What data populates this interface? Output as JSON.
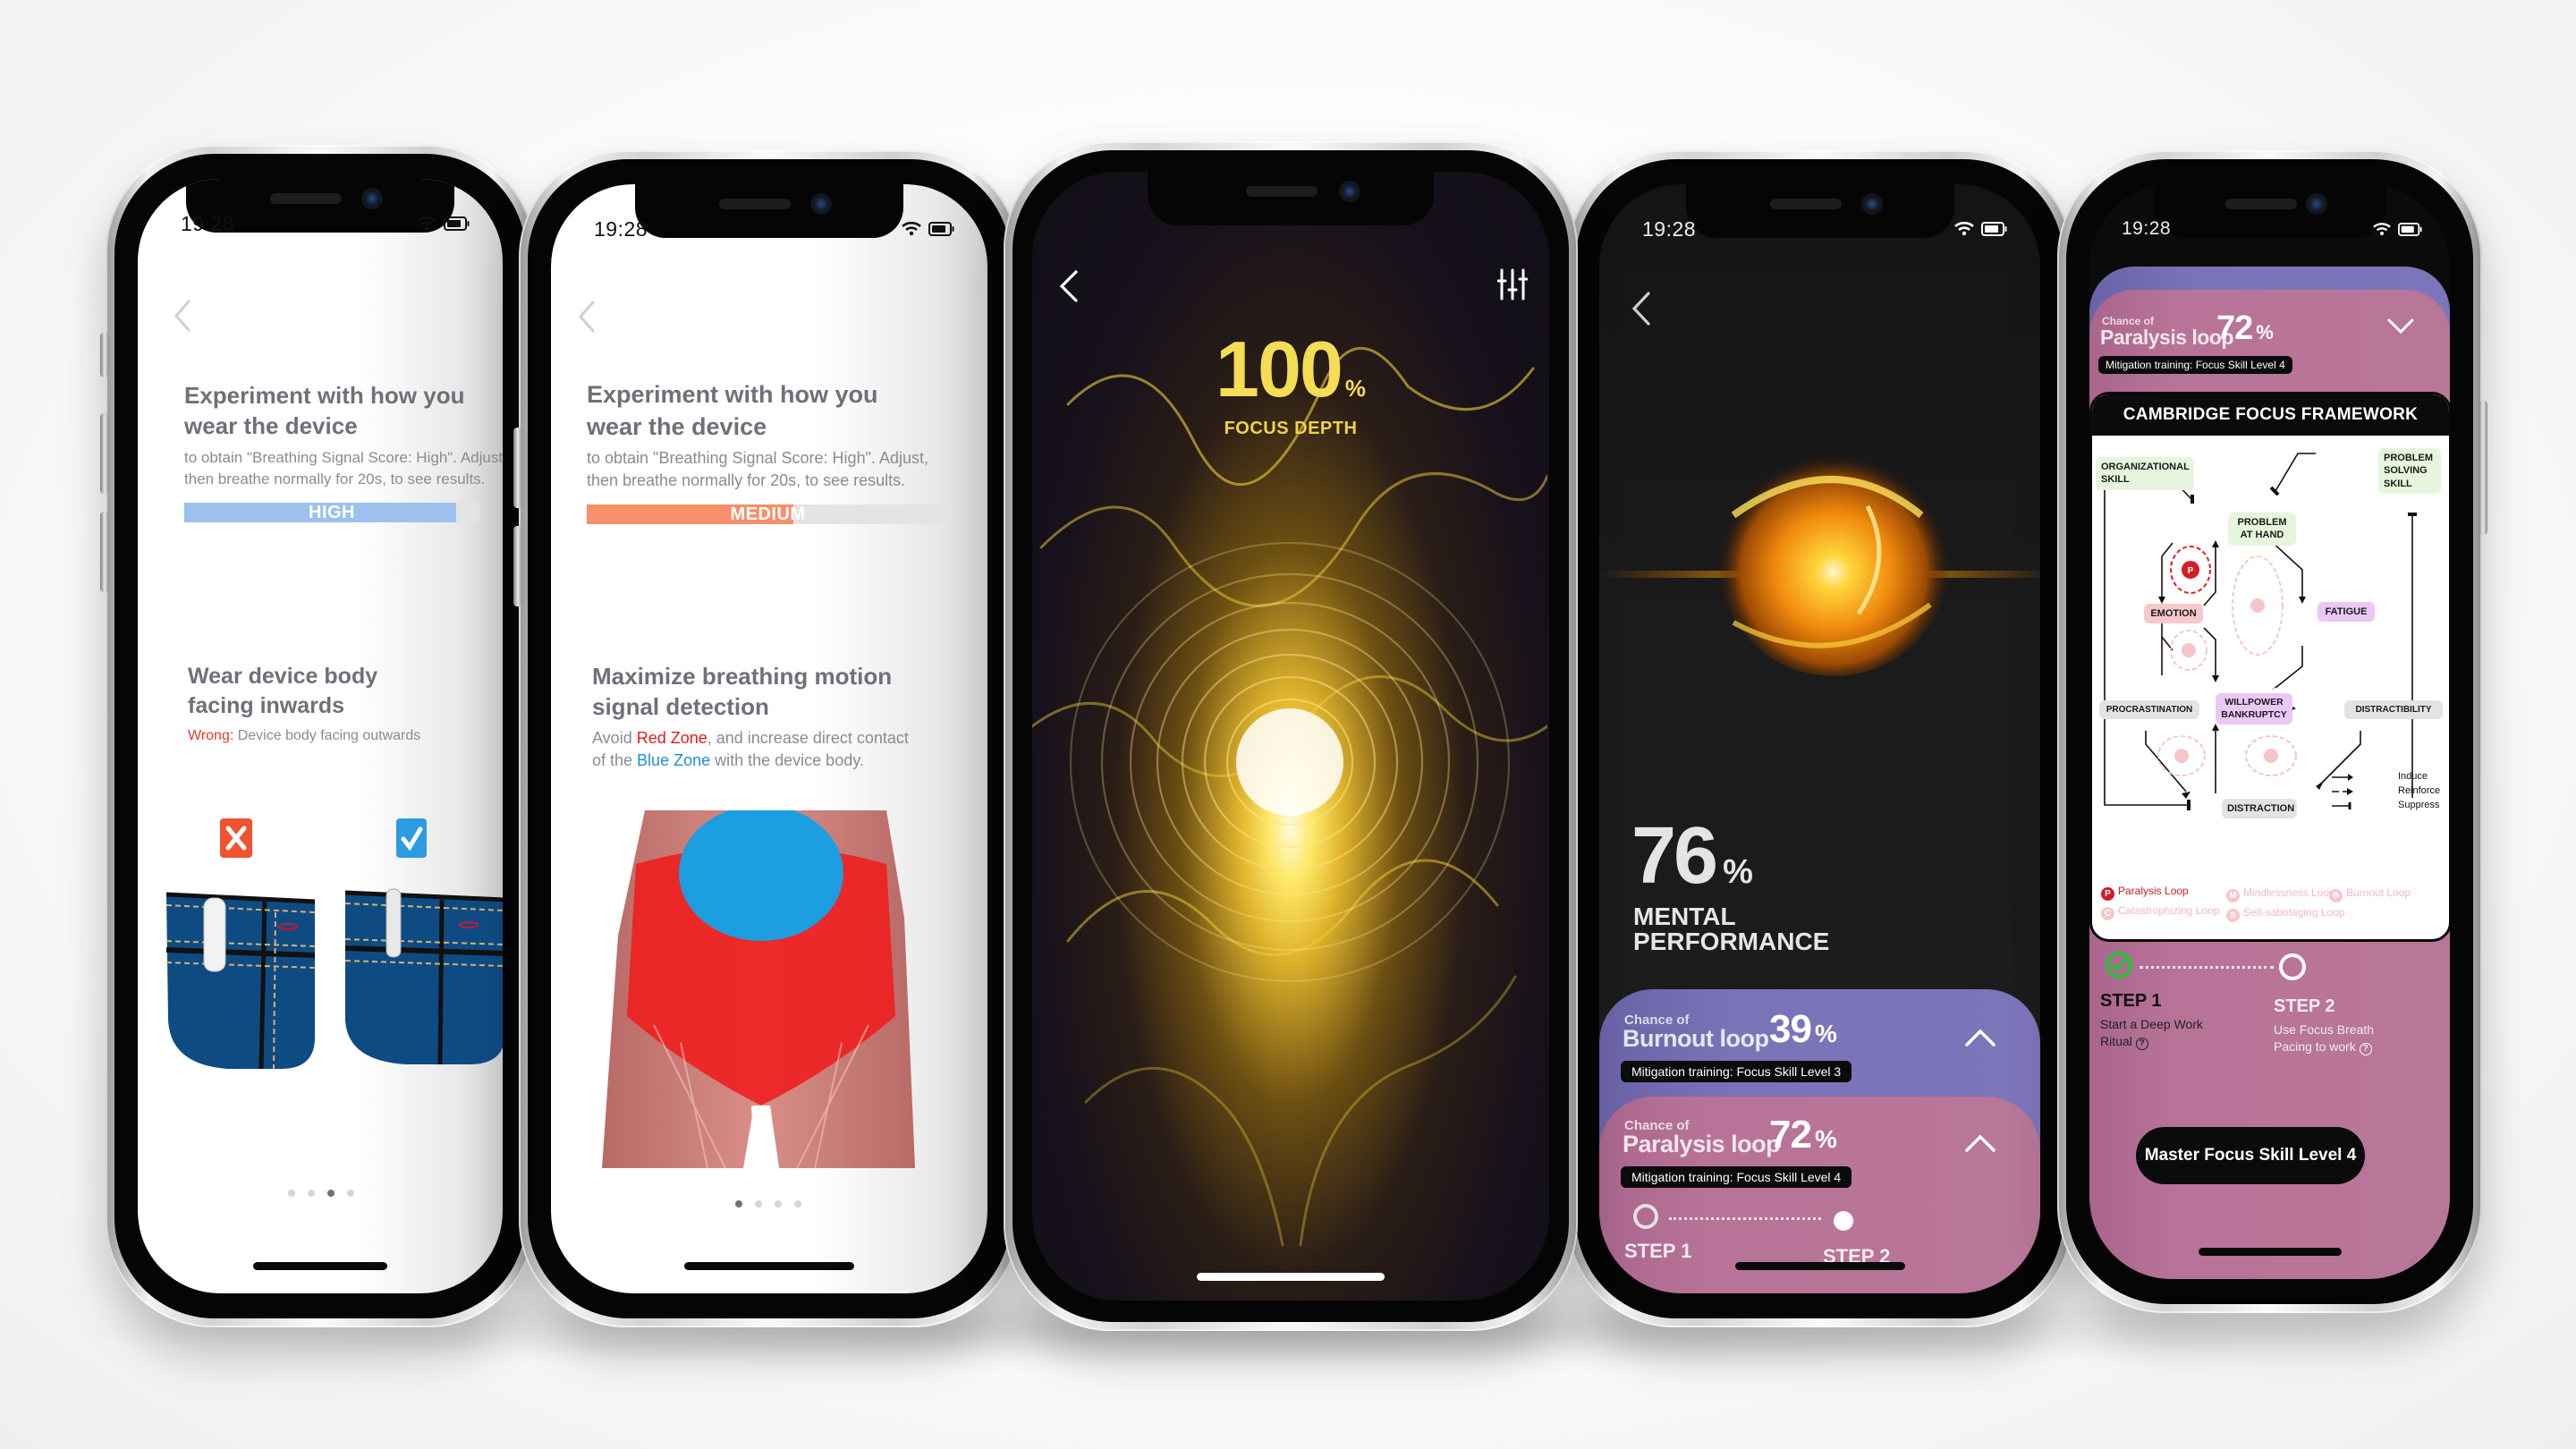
{
  "status_bar": {
    "time": "19:28"
  },
  "phone1": {
    "title": "Experiment with how you wear the device",
    "title_line1": "Experiment with how you",
    "title_line2": "wear the device",
    "subtitle_line1": "to obtain \"Breathing Signal Score: High\". Adjust,",
    "subtitle_line2": "then breathe normally for 20s, to see results.",
    "signal_label": "HIGH",
    "signal_level": 0.92,
    "signal_color": "#9cc1ee",
    "section_title_line1": "Wear device body",
    "section_title_line2": "facing inwards",
    "wrong_prefix": "Wrong:",
    "wrong_text": " Device body facing outwards",
    "wrong_icon": "x-mark-icon",
    "right_icon": "check-mark-icon",
    "page_dots": 4,
    "active_dot": 3
  },
  "phone2": {
    "title_line1": "Experiment with how you",
    "title_line2": "wear the device",
    "subtitle_line1": "to obtain \"Breathing Signal Score: High\". Adjust,",
    "subtitle_line2": "then breathe normally for 20s, to see results.",
    "signal_label": "MEDIUM",
    "signal_level": 0.57,
    "signal_color": "#f6906a",
    "section_title_line1": "Maximize breathing motion",
    "section_title_line2": "signal detection",
    "body_avoid": "Avoid ",
    "body_red_zone": "Red Zone",
    "body_mid": ", and increase direct contact",
    "body_of_the": "of the ",
    "body_blue_zone": "Blue Zone",
    "body_end": " with the device body.",
    "page_dots": 4,
    "active_dot": 1
  },
  "phone3": {
    "value": "100",
    "unit": "%",
    "label": "FOCUS DEPTH",
    "accent": "#f5dc55",
    "back_icon": "chevron-left-icon",
    "settings_icon": "sliders-icon"
  },
  "phone4": {
    "value": "76",
    "unit": "%",
    "label_line1": "MENTAL",
    "label_line2": "PERFORMANCE",
    "cards": [
      {
        "chance": "Chance of",
        "name": "Burnout loop",
        "pct": "39",
        "unit": "%",
        "mitigation": "Mitigation training: Focus Skill Level 3",
        "color": "#7d75b9"
      },
      {
        "chance": "Chance of",
        "name": "Paralysis loop",
        "pct": "72",
        "unit": "%",
        "mitigation": "Mitigation training: Focus Skill Level 4",
        "color": "#b87699"
      }
    ],
    "steps": [
      {
        "label": "STEP 1",
        "state": "pending"
      },
      {
        "label": "STEP 2",
        "state": "current"
      }
    ]
  },
  "phone5": {
    "card": {
      "chance": "Chance of",
      "name": "Paralysis loop",
      "pct": "72",
      "unit": "%",
      "mitigation": "Mitigation training: Focus Skill Level 4"
    },
    "framework": {
      "title": "CAMBRIDGE FOCUS FRAMEWORK",
      "nodes": {
        "organizational": "ORGANIZATIONAL SKILL",
        "problem_solving": "PROBLEM SOLVING SKILL",
        "problem_at_hand": "PROBLEM AT HAND",
        "emotion": "EMOTION",
        "fatigue": "FATIGUE",
        "procrastination": "PROCRASTINATION",
        "willpower": "WILLPOWER BANKRUPTCY",
        "distractibility": "DISTRACTIBILITY",
        "distraction": "DISTRACTION"
      },
      "legend": {
        "induce": "Induce",
        "reinforce": "Reinforce",
        "suppress": "Suppress"
      },
      "loops": [
        {
          "letter": "P",
          "label": "Paralysis Loop",
          "active": true
        },
        {
          "letter": "M",
          "label": "Mindlessness Loop",
          "active": false
        },
        {
          "letter": "B",
          "label": "Burnout Loop",
          "active": false
        },
        {
          "letter": "C",
          "label": "Catastrophizing Loop",
          "active": false
        },
        {
          "letter": "S",
          "label": "Self-sabotaging Loop",
          "active": false
        }
      ]
    },
    "steps": [
      {
        "label": "STEP 1",
        "desc_line1": "Start a Deep Work",
        "desc_line2": "Ritual",
        "state": "done"
      },
      {
        "label": "STEP 2",
        "desc_line1": "Use Focus Breath",
        "desc_line2": "Pacing to work",
        "state": "pending"
      }
    ],
    "cta": "Master Focus Skill Level 4"
  }
}
